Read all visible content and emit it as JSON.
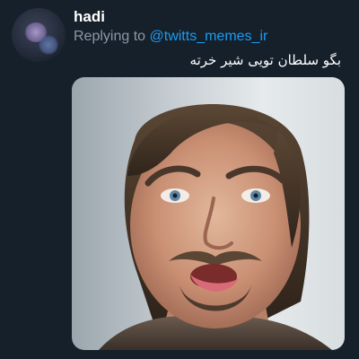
{
  "tweet": {
    "author_name": "hadi",
    "replying_prefix": "Replying to",
    "replying_handle": "@twitts_memes_ir",
    "text": "بگو سلطان تویی شیر خرته"
  },
  "media": {
    "description_icon": "meme-face-image"
  },
  "colors": {
    "background": "#15202b",
    "text_primary": "#ffffff",
    "text_secondary": "#8b98a5",
    "link": "#1d9bf0"
  }
}
